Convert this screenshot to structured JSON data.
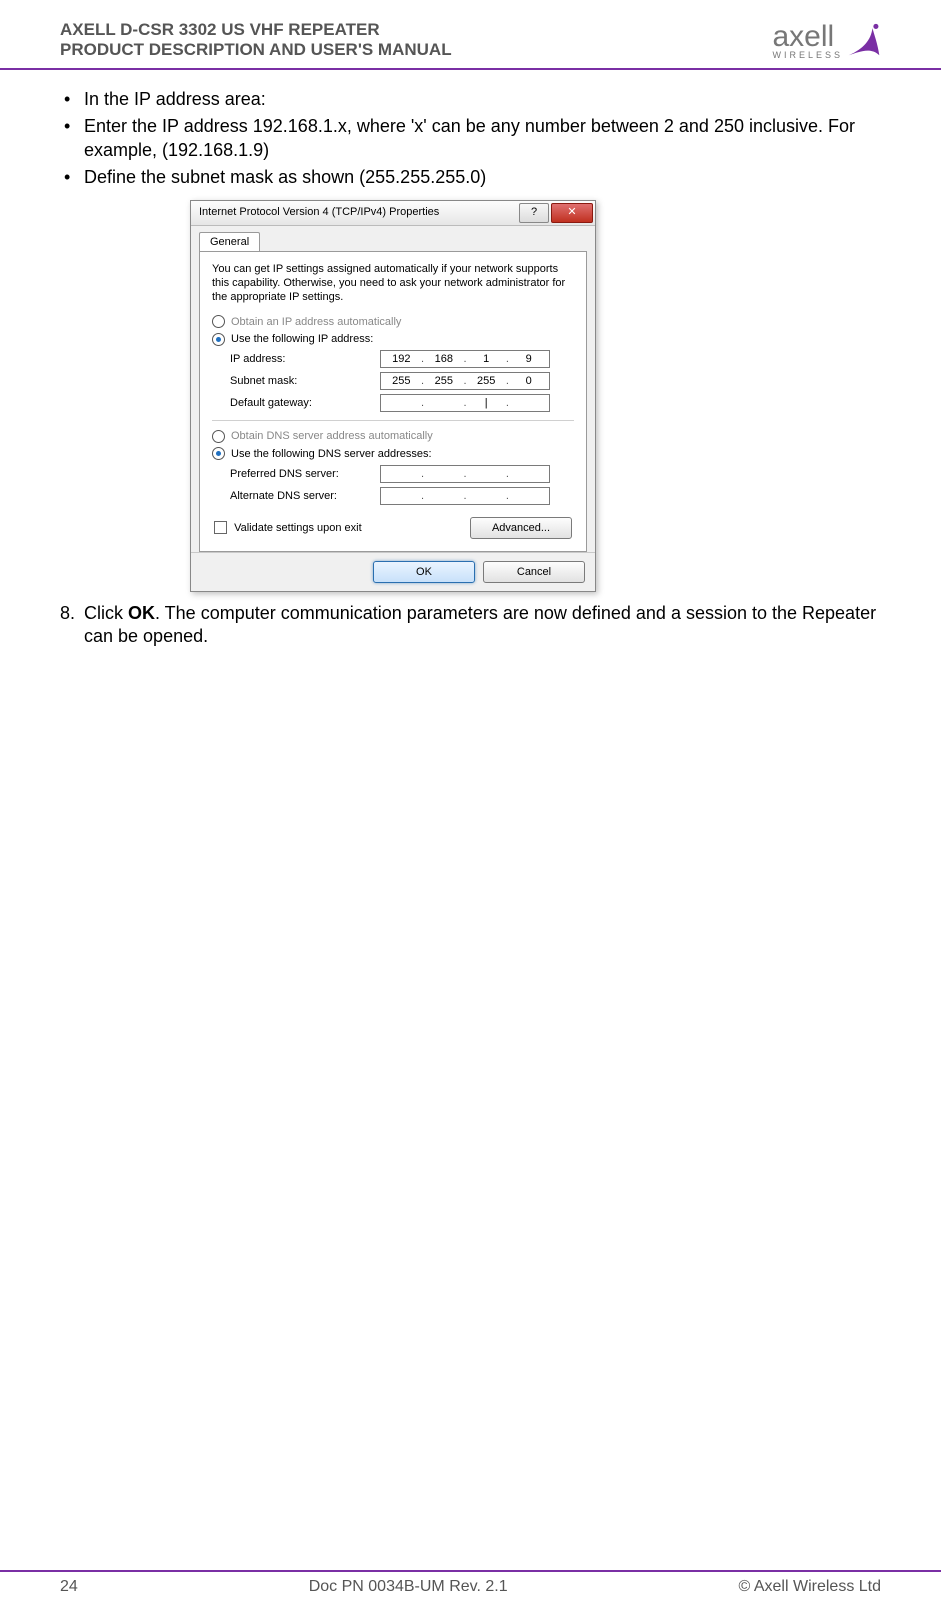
{
  "header": {
    "line1": "AXELL D-CSR 3302 US VHF REPEATER",
    "line2": "PRODUCT DESCRIPTION AND USER'S MANUAL",
    "logo_text": "axell",
    "logo_sub": "WIRELESS"
  },
  "bullets": [
    "In the IP address area:",
    "Enter the IP address 192.168.1.x, where 'x' can be any number between 2 and 250 inclusive. For example,  (192.168.1.9)",
    "Define the subnet mask as shown (255.255.255.0)"
  ],
  "dialog": {
    "title": "Internet Protocol Version 4 (TCP/IPv4) Properties",
    "tab": "General",
    "help": "You can get IP settings assigned automatically if your network supports this capability. Otherwise, you need to ask your network administrator for the appropriate IP settings.",
    "radio_auto_ip": "Obtain an IP address automatically",
    "radio_use_ip": "Use the following IP address:",
    "ip_label": "IP address:",
    "ip": [
      "192",
      "168",
      "1",
      "9"
    ],
    "subnet_label": "Subnet mask:",
    "subnet": [
      "255",
      "255",
      "255",
      "0"
    ],
    "gateway_label": "Default gateway:",
    "gateway": [
      "",
      "",
      "|",
      ""
    ],
    "radio_auto_dns": "Obtain DNS server address automatically",
    "radio_use_dns": "Use the following DNS server addresses:",
    "pref_dns_label": "Preferred DNS server:",
    "pref_dns": [
      "",
      "",
      "",
      ""
    ],
    "alt_dns_label": "Alternate DNS server:",
    "alt_dns": [
      "",
      "",
      "",
      ""
    ],
    "validate_label": "Validate settings upon exit",
    "advanced": "Advanced...",
    "ok": "OK",
    "cancel": "Cancel",
    "help_glyph": "?",
    "close_glyph": "✕"
  },
  "step8": {
    "num": "8.",
    "text_pre": "Click ",
    "bold": "OK",
    "text_post": ". The computer communication parameters are now defined and a session to the Repeater can be opened."
  },
  "footer": {
    "page": "24",
    "doc": "Doc PN 0034B-UM Rev. 2.1",
    "copyright": "© Axell Wireless Ltd"
  }
}
